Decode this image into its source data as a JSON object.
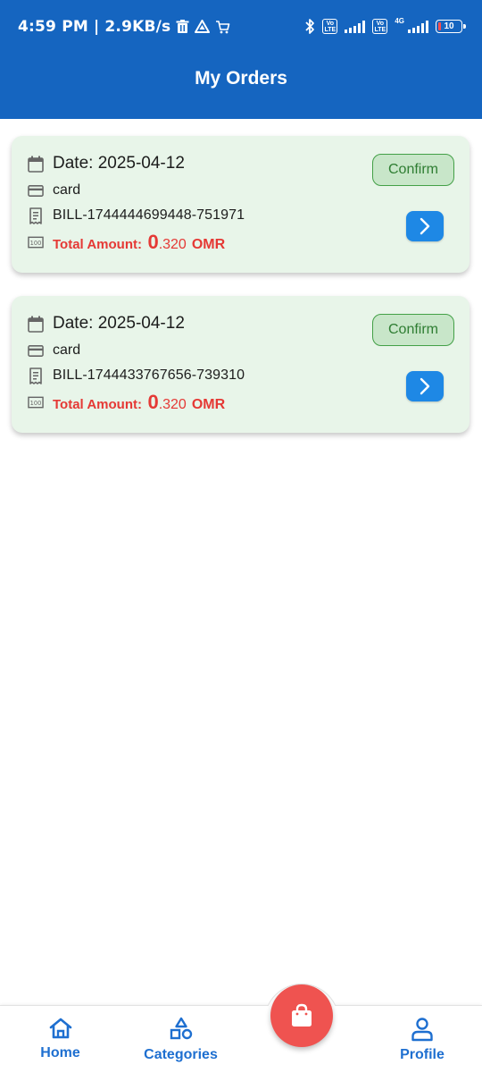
{
  "status_bar": {
    "time": "4:59 PM",
    "speed": "2.9KB/s",
    "network": "4G",
    "battery": "10",
    "volte_label": "Vo\nLTE"
  },
  "header": {
    "title": "My Orders",
    "background": "#1565c0"
  },
  "orders": [
    {
      "date": "Date: 2025-04-12",
      "payment": "card",
      "bill": "BILL-1744444699448-751971",
      "amount_label": "Total Amount:",
      "amount_int": "0",
      "amount_dec": ".320",
      "currency": "OMR",
      "status": "Confirm"
    },
    {
      "date": "Date: 2025-04-12",
      "payment": "card",
      "bill": "BILL-1744433767656-739310",
      "amount_label": "Total Amount:",
      "amount_int": "0",
      "amount_dec": ".320",
      "currency": "OMR",
      "status": "Confirm"
    }
  ],
  "bottom_nav": {
    "home": "Home",
    "categories": "Categories",
    "profile": "Profile",
    "cart_icon": "shopping-bag-icon"
  },
  "colors": {
    "accent": "#1e88e5",
    "card_bg": "#e8f5e9",
    "amount": "#e53935",
    "confirm": "#2e7d32",
    "fab": "#ef5350"
  }
}
